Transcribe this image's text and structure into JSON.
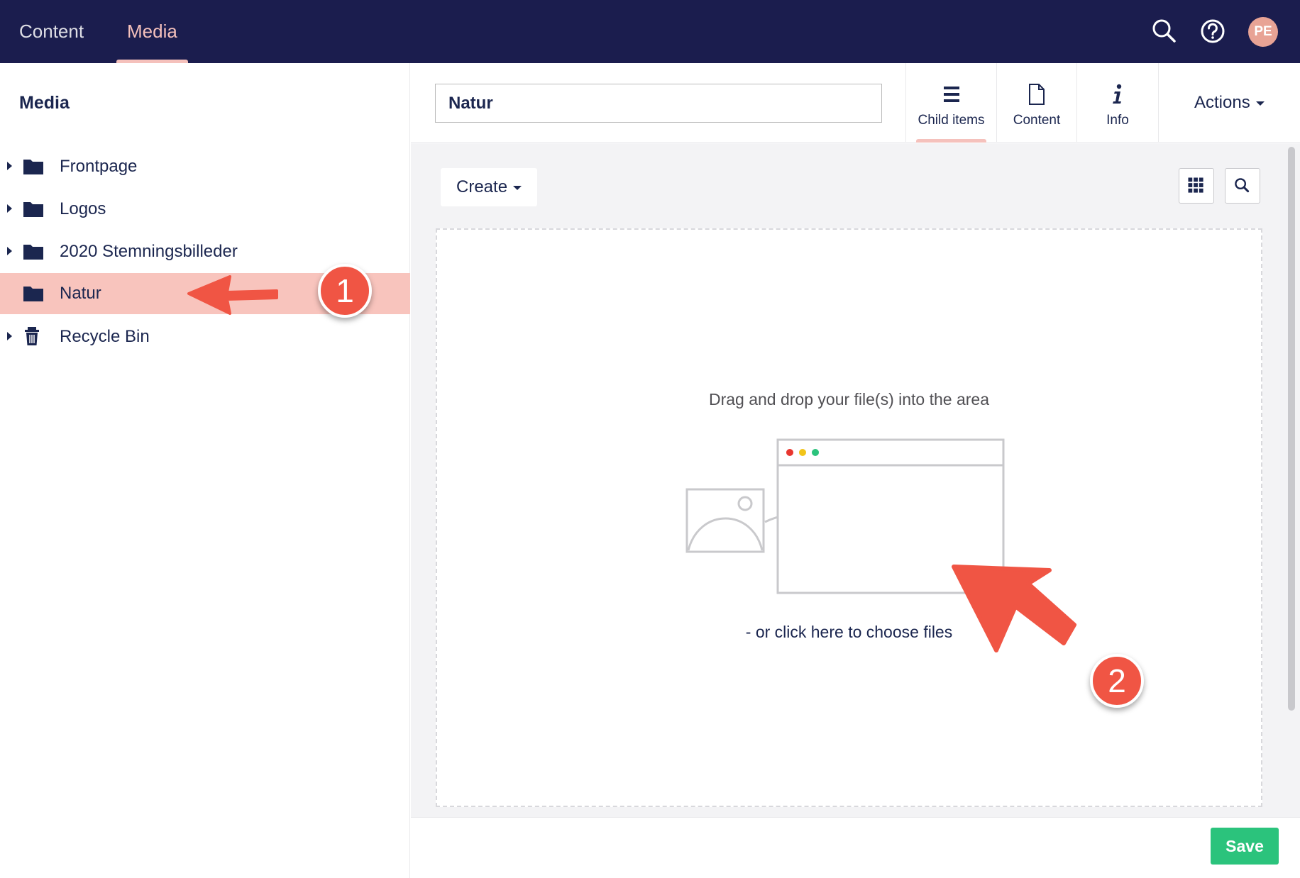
{
  "topnav": {
    "items": [
      {
        "label": "Content",
        "active": false
      },
      {
        "label": "Media",
        "active": true
      }
    ],
    "icons": [
      "search-icon",
      "help-icon"
    ],
    "avatar_initials": "PE"
  },
  "sidebar": {
    "title": "Media",
    "items": [
      {
        "label": "Frontpage",
        "icon": "folder-icon",
        "has_children": true,
        "selected": false
      },
      {
        "label": "Logos",
        "icon": "folder-icon",
        "has_children": true,
        "selected": false
      },
      {
        "label": "2020 Stemningsbilleder",
        "icon": "folder-icon",
        "has_children": true,
        "selected": false
      },
      {
        "label": "Natur",
        "icon": "folder-icon",
        "has_children": false,
        "selected": true
      },
      {
        "label": "Recycle Bin",
        "icon": "trash-icon",
        "has_children": true,
        "selected": false
      }
    ]
  },
  "header": {
    "name_value": "Natur",
    "tabs": [
      {
        "label": "Child items",
        "icon": "list-icon",
        "active": true
      },
      {
        "label": "Content",
        "icon": "document-icon",
        "active": false
      },
      {
        "label": "Info",
        "icon": "info-icon",
        "active": false
      }
    ],
    "actions_label": "Actions"
  },
  "main": {
    "create_label": "Create",
    "drop_text": "Drag and drop your file(s) into the area",
    "drop_link": "- or click here to choose files"
  },
  "footer": {
    "save_label": "Save"
  },
  "annotations": [
    {
      "number": "1"
    },
    {
      "number": "2"
    }
  ],
  "colors": {
    "topbar": "#1b1d4e",
    "accent": "#f5c1bc",
    "selected_row": "#f8c4bd",
    "save": "#2bc37c",
    "annotation": "#f05544"
  }
}
